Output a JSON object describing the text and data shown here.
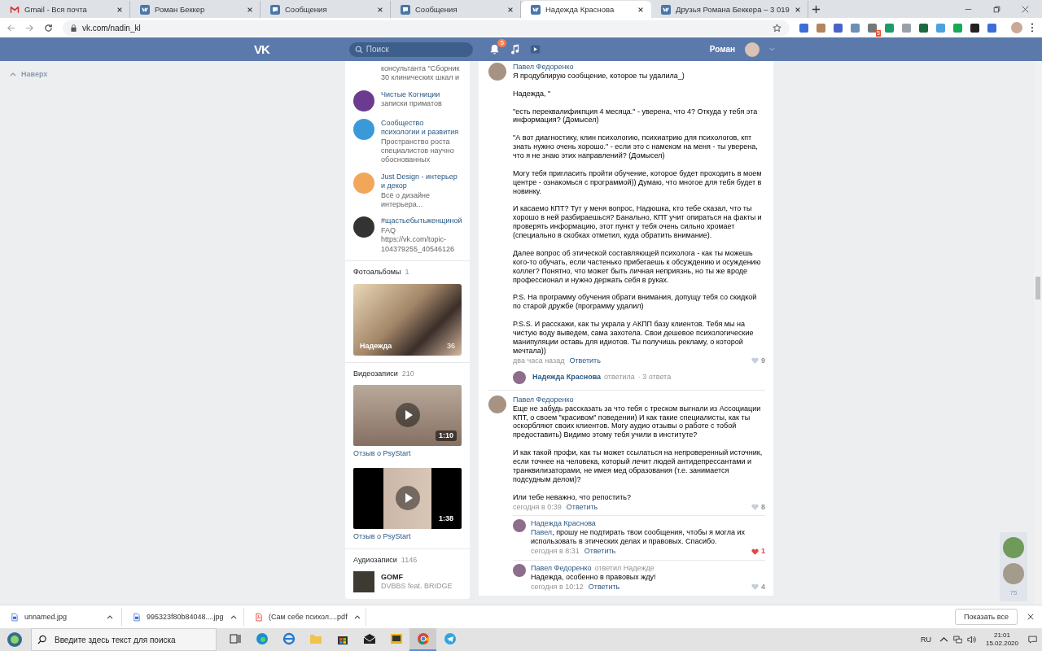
{
  "browser": {
    "tabs": [
      {
        "kind": "gmail",
        "title": "Gmail - Вся почта",
        "selected": false
      },
      {
        "kind": "vk",
        "title": "Роман Беккер",
        "selected": false
      },
      {
        "kind": "messages",
        "title": "Сообщения",
        "selected": false
      },
      {
        "kind": "messages",
        "title": "Сообщения",
        "selected": false
      },
      {
        "kind": "vk",
        "title": "Надежда Краснова",
        "selected": true
      },
      {
        "kind": "vk",
        "title": "Друзья Романа Беккера – 3 019",
        "selected": false
      }
    ],
    "url": "vk.com/nadin_kl",
    "extension_badge": "5"
  },
  "header": {
    "logo": "VK",
    "search_placeholder": "Поиск",
    "notifications_badge": "5",
    "user_name": "Роман"
  },
  "back_to_top": "Наверх",
  "sidebar": {
    "groups": [
      {
        "description": "консультанта \"Сборник 30 клинических шкал и"
      },
      {
        "name": "Чистые Когниции",
        "description": "записки приматов"
      },
      {
        "name": "Сообщество психологии и развития",
        "description": "Пространство роста специалистов научно обоснованных"
      },
      {
        "name": "Just Design - интерьер и декор",
        "description": "Всё о дизайне интерьера..."
      },
      {
        "name": "#щастьебытьженщиной",
        "description": "FAQ https://vk.com/topic-104379255_40546126"
      }
    ],
    "photos": {
      "title": "Фотоальбомы",
      "count": "1",
      "album": {
        "name": "Надежда",
        "count": "36"
      }
    },
    "videos": {
      "title": "Видеозаписи",
      "count": "210",
      "items": [
        {
          "duration": "1:10",
          "title": "Отзыв о PsyStart"
        },
        {
          "duration": "1:38",
          "title": "Отзыв о PsyStart"
        }
      ]
    },
    "audio": {
      "title": "Аудиозаписи",
      "count": "1146",
      "tracks": [
        {
          "title": "GOMF",
          "artist": "DVBBS feat. BRIDGE"
        }
      ]
    }
  },
  "comments": [
    {
      "author": "Павел Федоренко",
      "paragraphs": [
        "Я продублирую сообщение, которое ты удалила_)",
        "Надежда, \"",
        "\"есть переквалификпция 4 месяца.\" - уверена, что 4? Откуда у тебя эта информация? (Домысел)",
        "\"А вот диагностику, клин психологию, психиатрию для психологов, кпт знать нужно очень хорошо.\" - если это с намеком на меня - ты уверена, что я не знаю этих направлений? (Домысел)",
        "Могу тебя пригласить пройти обучение, которое будет проходить в моем центре - ознакомься с программой)) Думаю, что многое для тебя будет в новинку.",
        "И касаемо КПТ? Тут у меня вопрос, Надюшка, кто тебе сказал, что ты хорошо в ней разбираешься? Банально, КПТ учит опираться на факты и проверять информацию, этот пункт у тебя очень сильно хромает (специально в скобках отметил, куда обратить внимание).",
        "Далее вопрос об этической составляющей психолога - как ты можешь кого-то обучать, если частенько прибегаешь к обсуждению и осуждению коллег? Понятно, что может быть личная неприязнь, но ты же вроде профессионал и нужно держать себя в руках.",
        "P.S. На программу обучения обрати внимания, допущу тебя со скидкой по старой дружбе (программу удалил)",
        "P.S.S. И расскажи, как ты украла у АКПП базу клиентов. Тебя мы на чистую воду выведем, сама захотела. Свои дешевое психологические манипуляции оставь для идиотов. Ты получишь рекламу, о которой мечтала))"
      ],
      "time": "два часа назад",
      "reply": "Ответить",
      "likes": "9",
      "liked": false,
      "thread": {
        "author": "Надежда Краснова",
        "action": "ответила",
        "count": "· 3 ответа"
      }
    },
    {
      "author": "Павел Федоренко",
      "paragraphs": [
        "Еще не забудь рассказать за что тебя с треском выгнали из Ассоциации КПТ, о своем \"красивом\" поведении) И как такие специалисты, как ты оскорбляют своих клиентов. Могу аудио отзывы о работе с тобой предоставить) Видимо этому тебя учили в институте?",
        "И как такой профи, как ты может ссылаться на непроверенный источник, если точнее на человека, который лечит людей антидепрессантами и транквилизаторами, не имея мед образования (т.е. занимается подсудным делом)?",
        "Или тебе неважно, что репостить?"
      ],
      "time": "сегодня в 0:39",
      "reply": "Ответить",
      "likes": "8",
      "liked": false,
      "replies": [
        {
          "author": "Надежда Краснова",
          "mention": "Павел",
          "text": ", прошу не подтирать твои сообщения, чтобы я могла их использовать в этических делах и правовых. Спасибо.",
          "time": "сегодня в 8:31",
          "reply": "Ответить",
          "likes": "1",
          "liked": true
        },
        {
          "author": "Павел Федоренко",
          "addressee": "ответил Надежде",
          "text": "Надежда, особенно в правовых жду!",
          "time": "сегодня в 10:12",
          "reply": "Ответить",
          "likes": "4",
          "liked": false
        }
      ]
    }
  ],
  "friends_online": {
    "count": "75"
  },
  "downloads": {
    "items": [
      {
        "kind": "image",
        "name": "unnamed.jpg"
      },
      {
        "kind": "image",
        "name": "995323f80b84048....jpg"
      },
      {
        "kind": "pdf",
        "name": "(Сам себе психол....pdf"
      }
    ],
    "show_all": "Показать все"
  },
  "taskbar": {
    "search_placeholder": "Введите здесь текст для поиска",
    "apps": [
      {
        "kind": "taskview",
        "active": false
      },
      {
        "kind": "edge",
        "active": false
      },
      {
        "kind": "ie",
        "active": false
      },
      {
        "kind": "folder",
        "active": false
      },
      {
        "kind": "store",
        "active": false
      },
      {
        "kind": "mail",
        "active": false
      },
      {
        "kind": "slides",
        "active": false
      },
      {
        "kind": "chrome",
        "active": true
      },
      {
        "kind": "telegram",
        "active": false
      }
    ],
    "language": "RU",
    "time": "21:01",
    "date": "15.02.2020"
  }
}
